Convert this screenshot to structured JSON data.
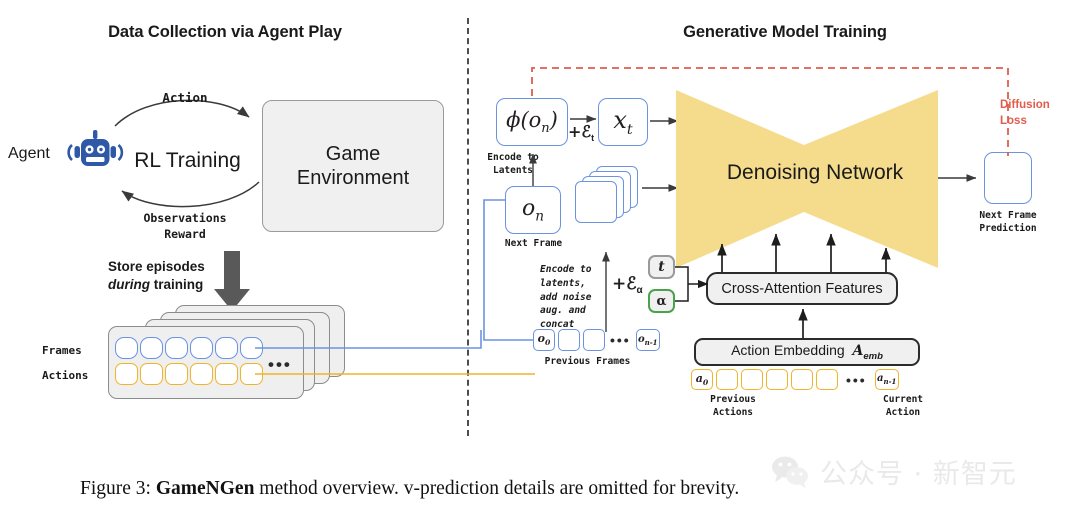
{
  "figure": {
    "caption_prefix": "Figure 3: ",
    "caption_bold": "GameNGen",
    "caption_rest": " method overview. v-prediction details are omitted for brevity."
  },
  "panels": {
    "left_title": "Data Collection via Agent Play",
    "right_title": "Generative Model Training"
  },
  "left": {
    "agent_label": "Agent",
    "agent_icon": "robot-icon",
    "action_label": "Action",
    "rl_label": "RL Training",
    "observations_label": "Observations\nReward",
    "env_line1": "Game",
    "env_line2": "Environment",
    "store_line1": "Store episodes",
    "store_line2_italic": "during",
    "store_line2_rest": " training",
    "frames_label": "Frames",
    "actions_label": "Actions",
    "ellipsis": "•••"
  },
  "right": {
    "phi_box": "ϕ(oₙ)",
    "phi_box_base": "ϕ(o",
    "phi_box_sub": "n",
    "phi_box_close": ")",
    "epsilon_t": "+ℰ",
    "epsilon_t_sub": "t",
    "xt_base": "x",
    "xt_sub": "t",
    "encode_to_latents": "Encode to\nLatents",
    "on_base": "o",
    "on_sub": "n",
    "next_frame_label": "Next Frame",
    "encode_block": "Encode to\nlatents,\nadd noise\naug. and\nconcat",
    "epsilon_a": "+ℰ",
    "epsilon_a_sub": "α",
    "denoising_network": "Denoising Network",
    "cross_attention": "Cross-Attention Features",
    "action_embedding": "Action Embedding",
    "action_embedding_sym": "A",
    "action_embedding_sub": "emb",
    "t_token": "t",
    "alpha_token": "α",
    "diffusion_loss": "Diffusion\nLoss",
    "next_frame_prediction": "Next Frame\nPrediction",
    "prev_frames_label": "Previous Frames",
    "prev_actions_label": "Previous\nActions",
    "current_action_label": "Current\nAction",
    "o0_base": "o",
    "o0_sub": "0",
    "on1_base": "o",
    "on1_sub": "n-1",
    "a0_base": "a",
    "a0_sub": "0",
    "an1_base": "a",
    "an1_sub": "n-1",
    "ellipsis": "•••"
  },
  "watermark": {
    "text": "公众号 · 新智元",
    "icon": "wechat-icon"
  },
  "colors": {
    "blue_border": "#6b93e0",
    "yellow_border": "#f0b429",
    "network_fill": "#f5dc8c",
    "red_loss": "#e05c4b",
    "green_border": "#4aa24a",
    "robot_blue": "#2f58a7",
    "arrow_gray": "#4d4d4d"
  }
}
